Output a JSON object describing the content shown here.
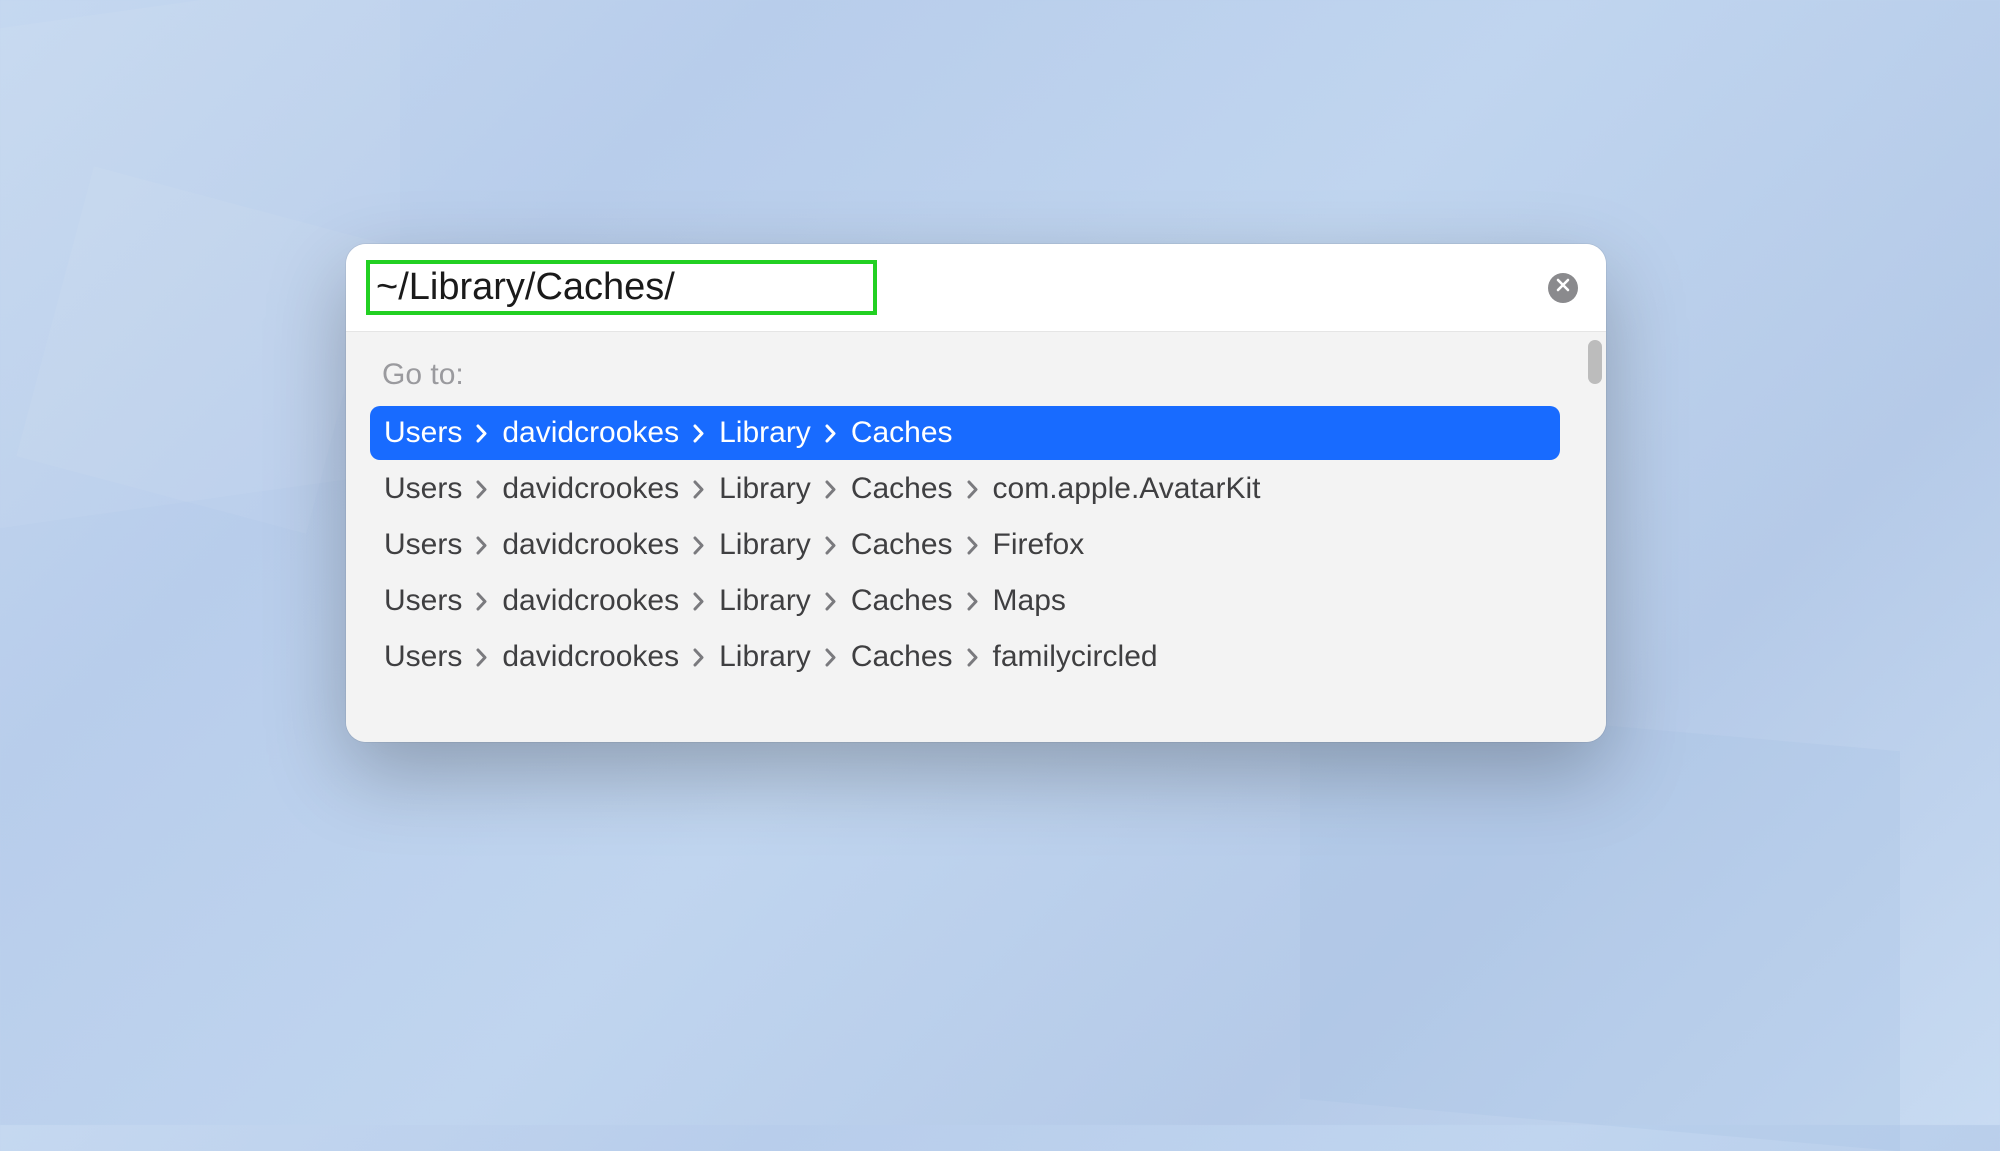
{
  "search": {
    "value": "~/Library/Caches/"
  },
  "section_label": "Go to:",
  "results": [
    {
      "segments": [
        "Users",
        "davidcrookes",
        "Library",
        "Caches"
      ],
      "selected": true
    },
    {
      "segments": [
        "Users",
        "davidcrookes",
        "Library",
        "Caches",
        "com.apple.AvatarKit"
      ],
      "selected": false
    },
    {
      "segments": [
        "Users",
        "davidcrookes",
        "Library",
        "Caches",
        "Firefox"
      ],
      "selected": false
    },
    {
      "segments": [
        "Users",
        "davidcrookes",
        "Library",
        "Caches",
        "Maps"
      ],
      "selected": false
    },
    {
      "segments": [
        "Users",
        "davidcrookes",
        "Library",
        "Caches",
        "familycircled"
      ],
      "selected": false
    }
  ]
}
